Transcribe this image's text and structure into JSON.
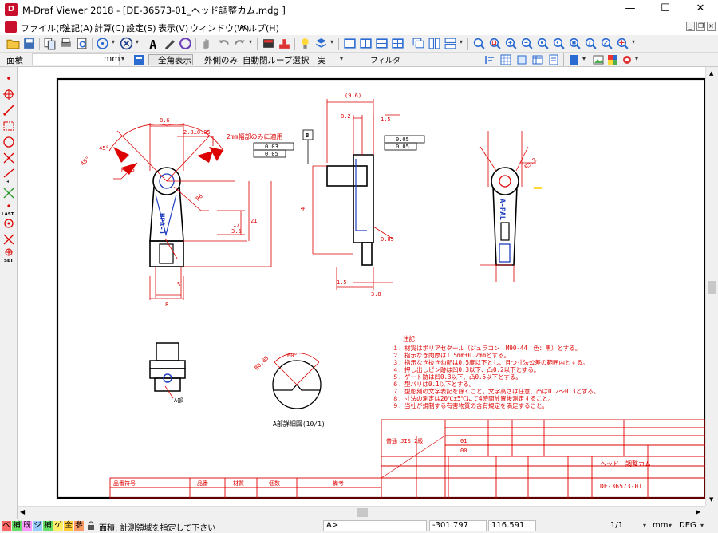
{
  "window": {
    "title": "M-Draf Viewer 2018 - [DE-36573-01_ヘッド調整カム.mdg ]",
    "app_icon_letter": "D",
    "minimize": "—",
    "maximize": "☐",
    "close": "✕"
  },
  "menu": {
    "items": [
      "ファイル(F)",
      "注記(A)",
      "計算(C)",
      "設定(S)",
      "表示(V)",
      "ウィンドウ(W)",
      "ヘルプ(H)"
    ],
    "mdi_buttons": [
      "_",
      "❐",
      "×"
    ]
  },
  "toolbar2": {
    "layer_label": "面積",
    "unit": "mm",
    "toggle1": "全角表示",
    "toggle2": "外側のみ",
    "toggle3": "自動閉ループ選択",
    "line_type": "実",
    "filter": "フィルタ"
  },
  "left_tools": [
    "point-tool",
    "crosshair-tool",
    "line-tool",
    "rect-select-tool",
    "circle-tool",
    "cross-tool",
    "angle-line-tool",
    "measure-tool",
    "last-tool",
    "origin-tool",
    "x-tool",
    "set-tool"
  ],
  "left_labels": {
    "last": "LAST",
    "set": "SET"
  },
  "drawing": {
    "notes_heading": "注記",
    "notes": [
      "１．材質はポリアセタール（ジュラコン　M90-44　色：黒）とする。",
      "２．指示なき肉厚は1.5mm±0.2mmとする。",
      "３．指示なき抜き勾配は0.5度以下とし、且つ寸法公差の範囲内とする。",
      "４．押し出しピン跡は凹0.3以下、凸0.2以下とする。",
      "５．ゲート跡は凹0.3以下、凸0.5以下とする。",
      "６．型バリは0.1以下とする。",
      "７．型彫刻の文字表記を除くこと。文字高さは任意、凸は0.2～0.3とする。",
      "８．寸法の測定は20℃±5℃にて4時間放置後測定すること。",
      "９．当社が規制する有害物質の含有規定を満足すること。"
    ],
    "dims": [
      "8.6",
      "2.8±0.05",
      "45°",
      "45°",
      "R0.5",
      "R6",
      "6.5",
      "17",
      "21",
      "3.5",
      "5",
      "8",
      "(9.6)",
      "8.2",
      "1.5",
      "4",
      "1.5",
      "3.8",
      "0.05",
      "R3.2",
      "60°",
      "R0.05"
    ],
    "callout": "2mm幅部のみに適用",
    "gdt": [
      "0.03",
      "0.05",
      "0.05",
      "0.05"
    ],
    "datum": "B",
    "part_mark": "HPA-1",
    "part_mark_right": "A-PAL",
    "view_label": "A部",
    "detail_label": "A部詳細図(10/1)",
    "title_block": {
      "part_name": "ヘッド　調整カム",
      "drawing_no": "DE-36573-01",
      "col_headers": [
        "品番符号",
        "品番",
        "材質",
        "個数",
        "備考"
      ],
      "rev_rows": [
        "01",
        "00"
      ],
      "jis": "普通 JIS 2級"
    }
  },
  "status": {
    "modes": [
      "ベ",
      "補",
      "既",
      "ジ",
      "補",
      "ゲ",
      "全",
      "参"
    ],
    "mode_colors": [
      "#ff6666",
      "#66dd66",
      "#ff99ff",
      "#99ccff",
      "#66dd66",
      "#ffee66",
      "#ffcc33",
      "#ff9966"
    ],
    "message": "面積: 計測領域を指定して下さい",
    "command_input": "A>",
    "x_coord": "-301.797",
    "y_coord": "116.591",
    "page": "1/1",
    "unit": "mm",
    "angle_unit": "DEG"
  }
}
